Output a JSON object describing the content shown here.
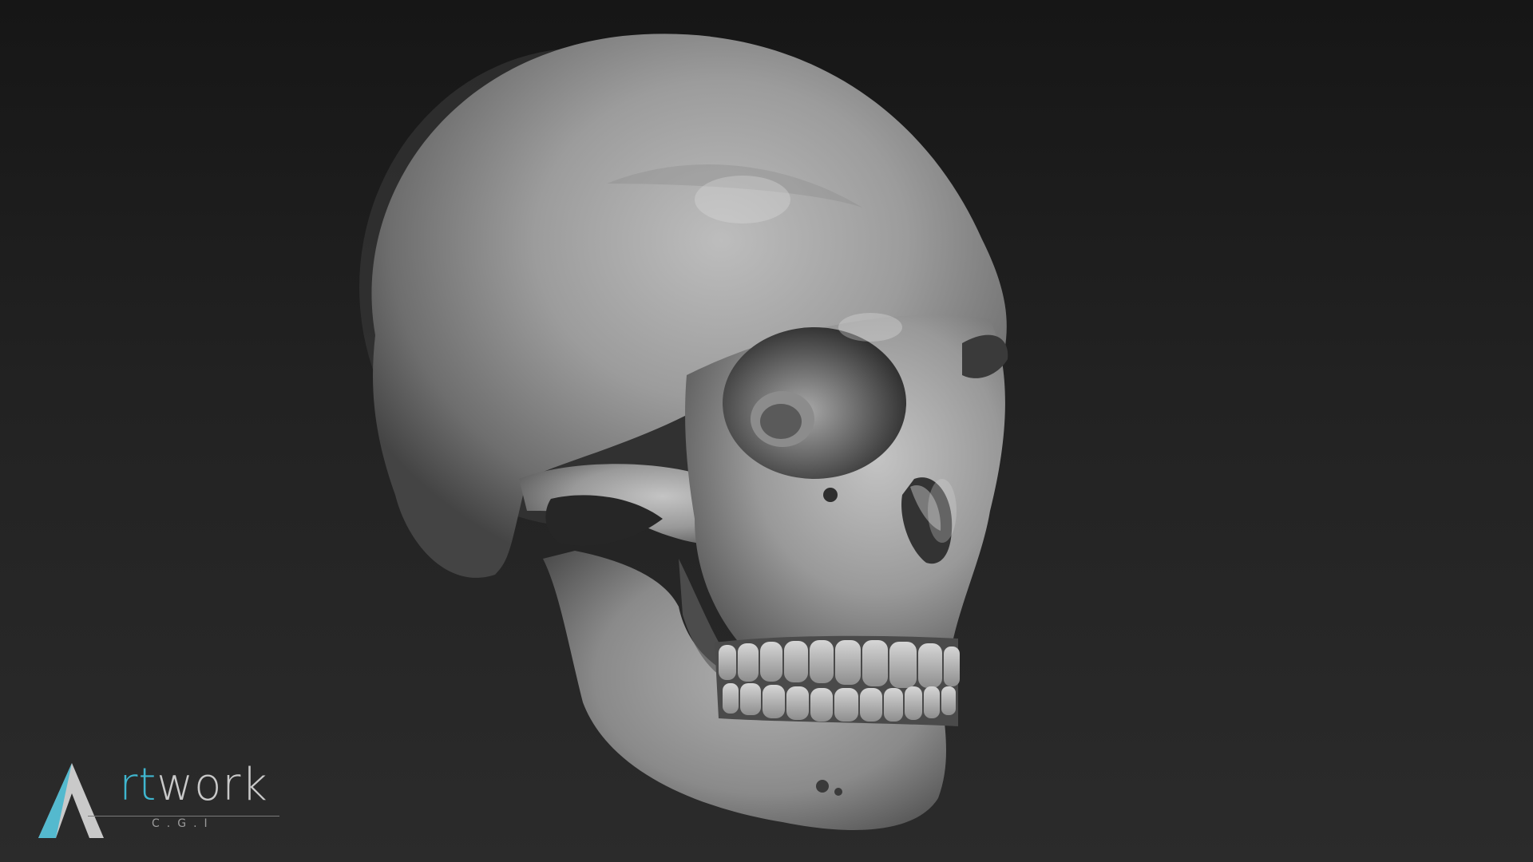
{
  "scene": {
    "subject": "skull-render",
    "background_color": "#222222",
    "model_color": "#9a9a9a"
  },
  "logo": {
    "word_prefix": "A",
    "word_accent": "rt",
    "word_rest": "work",
    "subtitle": "C.G.I",
    "accent_color": "#3fb6cf",
    "text_color": "#c9c9c9"
  }
}
